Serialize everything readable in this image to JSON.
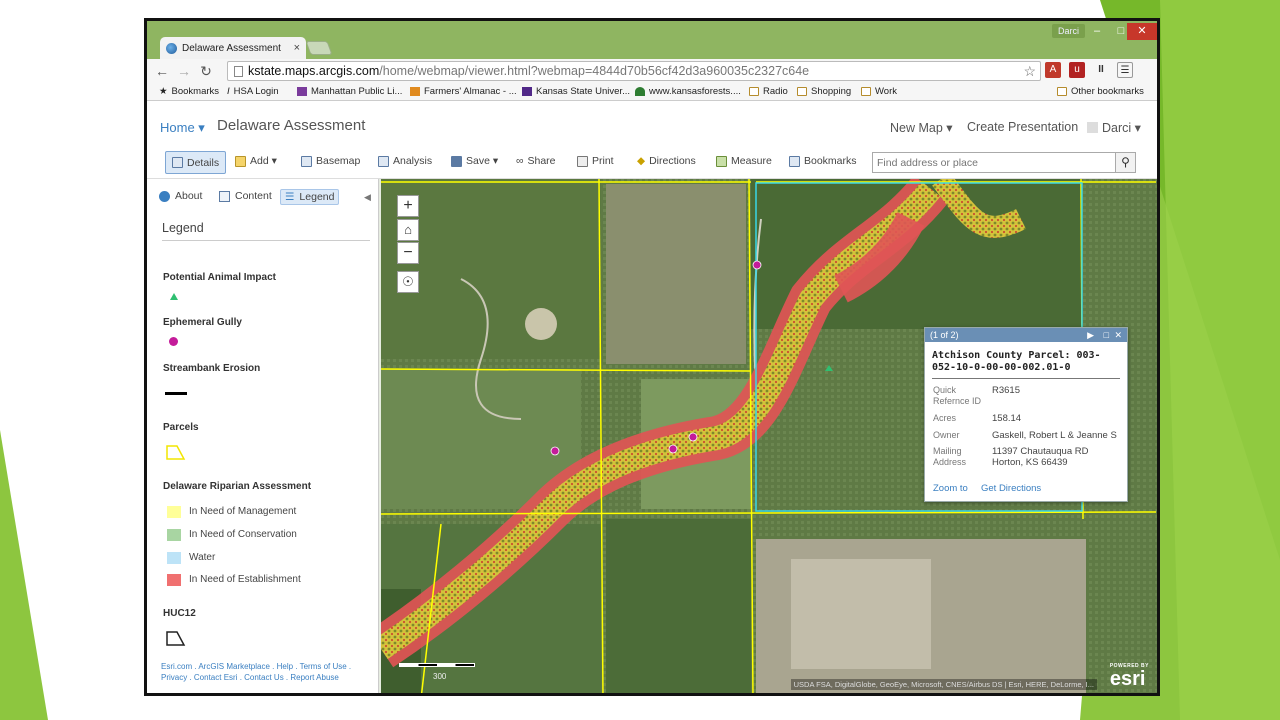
{
  "browser": {
    "tab_title": "Delaware Assessment",
    "tab_close": "×",
    "window_user": "Darci",
    "url_host": "kstate.maps.arcgis.com",
    "url_path": "/home/webmap/viewer.html?webmap=4844d70b56cf42d3a960035c2327c64e"
  },
  "bookmarks": {
    "items": [
      "Bookmarks",
      "HSA Login",
      "Manhattan Public Li...",
      "Farmers' Almanac - ...",
      "Kansas State Univer...",
      "www.kansasforests....",
      "Radio",
      "Shopping",
      "Work"
    ],
    "other": "Other bookmarks"
  },
  "header": {
    "home": "Home ▾",
    "title": "Delaware Assessment",
    "new_map": "New Map ▾",
    "create_presentation": "Create Presentation",
    "user": "Darci ▾"
  },
  "toolbar": {
    "details": "Details",
    "add": "Add ▾",
    "basemap": "Basemap",
    "analysis": "Analysis",
    "save": "Save ▾",
    "share": "Share",
    "print": "Print",
    "directions": "Directions",
    "measure": "Measure",
    "bookmarks": "Bookmarks",
    "find_placeholder": "Find address or place"
  },
  "sidebar": {
    "tabs": [
      "About",
      "Content",
      "Legend"
    ],
    "legend_title": "Legend",
    "layers": {
      "animal_impact": "Potential Animal Impact",
      "gully": "Ephemeral Gully",
      "streambank": "Streambank Erosion",
      "parcels": "Parcels",
      "riparian": "Delaware Riparian Assessment",
      "huc12": "HUC12"
    },
    "riparian_classes": [
      "In Need of Management",
      "In Need of Conservation",
      "Water",
      "In Need of Establishment"
    ],
    "footer_line1": "Esri.com . ArcGIS Marketplace . Help . Terms of Use .",
    "footer_line2": "Privacy . Contact Esri . Contact Us . Report Abuse"
  },
  "map": {
    "attribution": "USDA FSA, DigitalGlobe, GeoEye, Microsoft, CNES/Airbus DS | Esri, HERE, DeLorme, I...",
    "powered_by": "POWERED BY",
    "esri": "esri",
    "scale_label": "300"
  },
  "popup": {
    "counter": "(1 of 2)",
    "title": "Atchison County Parcel: 003-052-10-0-00-00-002.01-0",
    "fields": [
      {
        "label": "Quick Refernce ID",
        "value": "R3615"
      },
      {
        "label": "Acres",
        "value": "158.14"
      },
      {
        "label": "Owner",
        "value": "Gaskell, Robert L & Jeanne S"
      },
      {
        "label": "Mailing Address",
        "value": "11397 Chautauqua RD Horton, KS 66439"
      }
    ],
    "zoom_to": "Zoom to",
    "get_directions": "Get Directions"
  },
  "colors": {
    "slide_green": "#8dc63f",
    "management": "#ffff99",
    "conservation": "#a8d5a2",
    "water": "#bde3f7",
    "establishment": "#f07070",
    "gully": "#c41c9a",
    "parcel": "#ffff00",
    "accent": "#3a7fc1"
  }
}
